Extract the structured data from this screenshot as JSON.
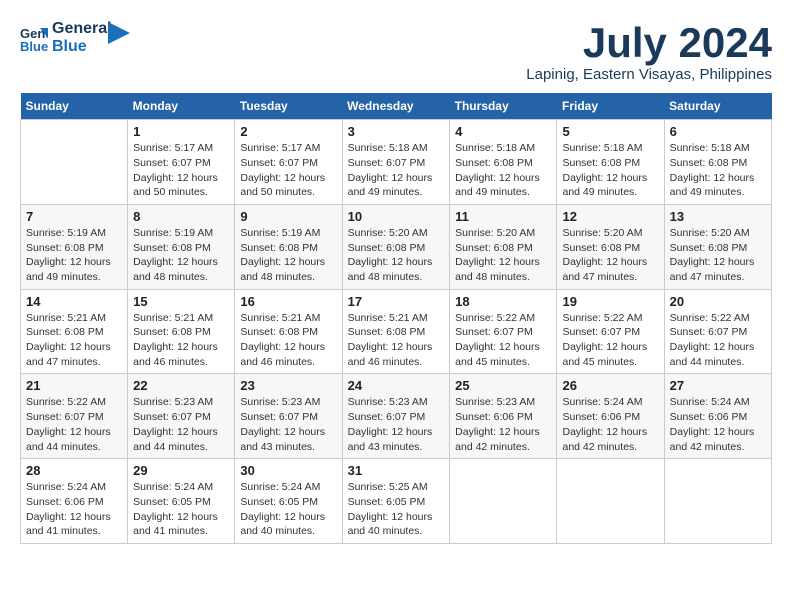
{
  "header": {
    "logo_line1": "General",
    "logo_line2": "Blue",
    "month": "July 2024",
    "location": "Lapinig, Eastern Visayas, Philippines"
  },
  "weekdays": [
    "Sunday",
    "Monday",
    "Tuesday",
    "Wednesday",
    "Thursday",
    "Friday",
    "Saturday"
  ],
  "weeks": [
    [
      {
        "day": "",
        "info": ""
      },
      {
        "day": "1",
        "info": "Sunrise: 5:17 AM\nSunset: 6:07 PM\nDaylight: 12 hours\nand 50 minutes."
      },
      {
        "day": "2",
        "info": "Sunrise: 5:17 AM\nSunset: 6:07 PM\nDaylight: 12 hours\nand 50 minutes."
      },
      {
        "day": "3",
        "info": "Sunrise: 5:18 AM\nSunset: 6:07 PM\nDaylight: 12 hours\nand 49 minutes."
      },
      {
        "day": "4",
        "info": "Sunrise: 5:18 AM\nSunset: 6:08 PM\nDaylight: 12 hours\nand 49 minutes."
      },
      {
        "day": "5",
        "info": "Sunrise: 5:18 AM\nSunset: 6:08 PM\nDaylight: 12 hours\nand 49 minutes."
      },
      {
        "day": "6",
        "info": "Sunrise: 5:18 AM\nSunset: 6:08 PM\nDaylight: 12 hours\nand 49 minutes."
      }
    ],
    [
      {
        "day": "7",
        "info": "Sunrise: 5:19 AM\nSunset: 6:08 PM\nDaylight: 12 hours\nand 49 minutes."
      },
      {
        "day": "8",
        "info": "Sunrise: 5:19 AM\nSunset: 6:08 PM\nDaylight: 12 hours\nand 48 minutes."
      },
      {
        "day": "9",
        "info": "Sunrise: 5:19 AM\nSunset: 6:08 PM\nDaylight: 12 hours\nand 48 minutes."
      },
      {
        "day": "10",
        "info": "Sunrise: 5:20 AM\nSunset: 6:08 PM\nDaylight: 12 hours\nand 48 minutes."
      },
      {
        "day": "11",
        "info": "Sunrise: 5:20 AM\nSunset: 6:08 PM\nDaylight: 12 hours\nand 48 minutes."
      },
      {
        "day": "12",
        "info": "Sunrise: 5:20 AM\nSunset: 6:08 PM\nDaylight: 12 hours\nand 47 minutes."
      },
      {
        "day": "13",
        "info": "Sunrise: 5:20 AM\nSunset: 6:08 PM\nDaylight: 12 hours\nand 47 minutes."
      }
    ],
    [
      {
        "day": "14",
        "info": "Sunrise: 5:21 AM\nSunset: 6:08 PM\nDaylight: 12 hours\nand 47 minutes."
      },
      {
        "day": "15",
        "info": "Sunrise: 5:21 AM\nSunset: 6:08 PM\nDaylight: 12 hours\nand 46 minutes."
      },
      {
        "day": "16",
        "info": "Sunrise: 5:21 AM\nSunset: 6:08 PM\nDaylight: 12 hours\nand 46 minutes."
      },
      {
        "day": "17",
        "info": "Sunrise: 5:21 AM\nSunset: 6:08 PM\nDaylight: 12 hours\nand 46 minutes."
      },
      {
        "day": "18",
        "info": "Sunrise: 5:22 AM\nSunset: 6:07 PM\nDaylight: 12 hours\nand 45 minutes."
      },
      {
        "day": "19",
        "info": "Sunrise: 5:22 AM\nSunset: 6:07 PM\nDaylight: 12 hours\nand 45 minutes."
      },
      {
        "day": "20",
        "info": "Sunrise: 5:22 AM\nSunset: 6:07 PM\nDaylight: 12 hours\nand 44 minutes."
      }
    ],
    [
      {
        "day": "21",
        "info": "Sunrise: 5:22 AM\nSunset: 6:07 PM\nDaylight: 12 hours\nand 44 minutes."
      },
      {
        "day": "22",
        "info": "Sunrise: 5:23 AM\nSunset: 6:07 PM\nDaylight: 12 hours\nand 44 minutes."
      },
      {
        "day": "23",
        "info": "Sunrise: 5:23 AM\nSunset: 6:07 PM\nDaylight: 12 hours\nand 43 minutes."
      },
      {
        "day": "24",
        "info": "Sunrise: 5:23 AM\nSunset: 6:07 PM\nDaylight: 12 hours\nand 43 minutes."
      },
      {
        "day": "25",
        "info": "Sunrise: 5:23 AM\nSunset: 6:06 PM\nDaylight: 12 hours\nand 42 minutes."
      },
      {
        "day": "26",
        "info": "Sunrise: 5:24 AM\nSunset: 6:06 PM\nDaylight: 12 hours\nand 42 minutes."
      },
      {
        "day": "27",
        "info": "Sunrise: 5:24 AM\nSunset: 6:06 PM\nDaylight: 12 hours\nand 42 minutes."
      }
    ],
    [
      {
        "day": "28",
        "info": "Sunrise: 5:24 AM\nSunset: 6:06 PM\nDaylight: 12 hours\nand 41 minutes."
      },
      {
        "day": "29",
        "info": "Sunrise: 5:24 AM\nSunset: 6:05 PM\nDaylight: 12 hours\nand 41 minutes."
      },
      {
        "day": "30",
        "info": "Sunrise: 5:24 AM\nSunset: 6:05 PM\nDaylight: 12 hours\nand 40 minutes."
      },
      {
        "day": "31",
        "info": "Sunrise: 5:25 AM\nSunset: 6:05 PM\nDaylight: 12 hours\nand 40 minutes."
      },
      {
        "day": "",
        "info": ""
      },
      {
        "day": "",
        "info": ""
      },
      {
        "day": "",
        "info": ""
      }
    ]
  ]
}
